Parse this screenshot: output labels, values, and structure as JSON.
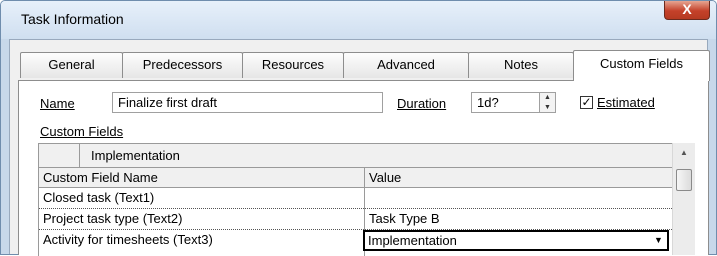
{
  "window": {
    "title": "Task Information",
    "close_glyph": "X"
  },
  "tabs": [
    {
      "label": "General"
    },
    {
      "label": "Predecessors"
    },
    {
      "label": "Resources"
    },
    {
      "label": "Advanced"
    },
    {
      "label": "Notes"
    },
    {
      "label": "Custom Fields",
      "active": true
    }
  ],
  "form": {
    "name_label": "Name",
    "name_value": "Finalize first draft",
    "duration_label": "Duration",
    "duration_value": "1d?",
    "estimated_label": "Estimated",
    "estimated_checked": true,
    "custom_fields_label": "Custom Fields"
  },
  "grid": {
    "edit_value": "Implementation",
    "columns": [
      "Custom Field Name",
      "Value"
    ],
    "rows": [
      {
        "name": "Closed task (Text1)",
        "value": ""
      },
      {
        "name": "Project task type (Text2)",
        "value": "Task Type B"
      },
      {
        "name": "Activity for timesheets (Text3)",
        "value": "Implementation",
        "dropdown": true
      }
    ]
  },
  "icons": {
    "spin_up": "up-arrow-icon",
    "spin_down": "down-arrow-icon",
    "check": "checkmark-icon",
    "scroll_up": "scroll-up-arrow-icon",
    "dropdown": "chevron-down-icon"
  },
  "colors": {
    "title_bar": "#cfdff0",
    "close_button": "#c4412a",
    "panel": "#ffffff",
    "dialog_bg": "#f0f0f0"
  }
}
